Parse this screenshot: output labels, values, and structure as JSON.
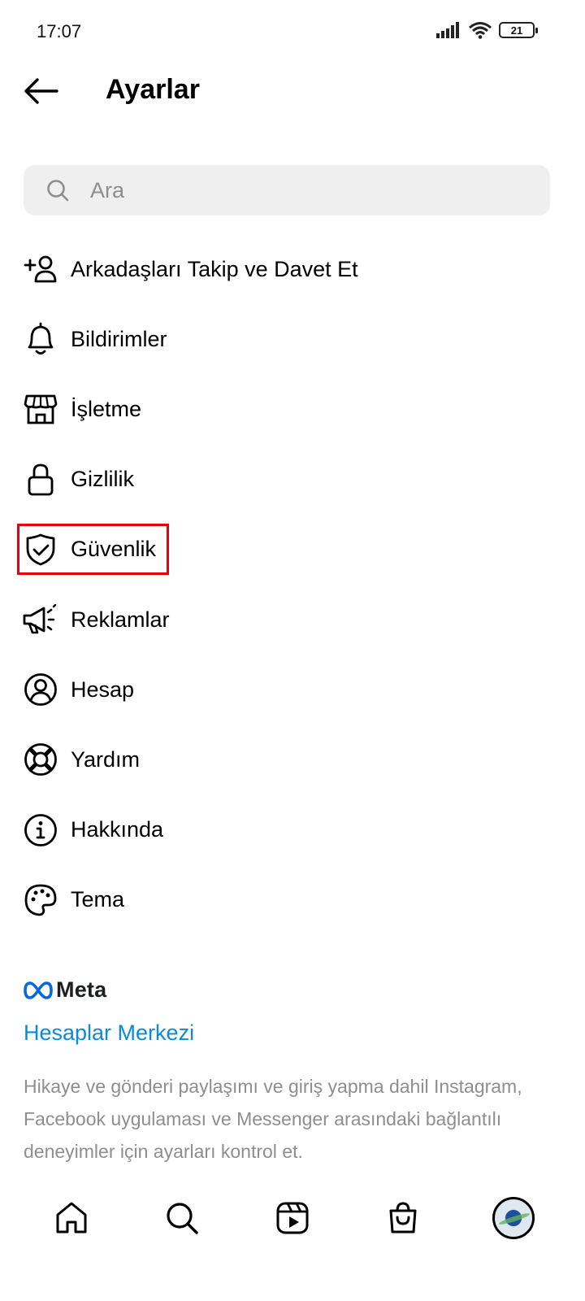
{
  "status_bar": {
    "time": "17:07",
    "battery": "21"
  },
  "header": {
    "title": "Ayarlar"
  },
  "search": {
    "placeholder": "Ara",
    "value": ""
  },
  "menu": [
    {
      "label": "Arkadaşları Takip ve Davet Et",
      "icon": "add-user-icon"
    },
    {
      "label": "Bildirimler",
      "icon": "bell-icon"
    },
    {
      "label": "İşletme",
      "icon": "store-icon"
    },
    {
      "label": "Gizlilik",
      "icon": "lock-icon"
    },
    {
      "label": "Güvenlik",
      "icon": "shield-check-icon"
    },
    {
      "label": "Reklamlar",
      "icon": "megaphone-icon"
    },
    {
      "label": "Hesap",
      "icon": "account-circle-icon"
    },
    {
      "label": "Yardım",
      "icon": "lifebuoy-icon"
    },
    {
      "label": "Hakkında",
      "icon": "info-icon"
    },
    {
      "label": "Tema",
      "icon": "palette-icon"
    }
  ],
  "meta": {
    "brand": "Meta",
    "accounts_center": "Hesaplar Merkezi",
    "description": "Hikaye ve gönderi paylaşımı ve giriş yapma dahil Instagram, Facebook uygulaması ve Messenger arasındaki bağlantılı deneyimler için ayarları kontrol et."
  },
  "colors": {
    "link": "#0a8ad8",
    "highlight": "#e8000b",
    "search_bg": "#efefef",
    "muted_text": "#8e8e8e"
  },
  "bottom_nav": [
    "home-icon",
    "search-icon",
    "reels-icon",
    "shop-icon",
    "profile-avatar"
  ]
}
